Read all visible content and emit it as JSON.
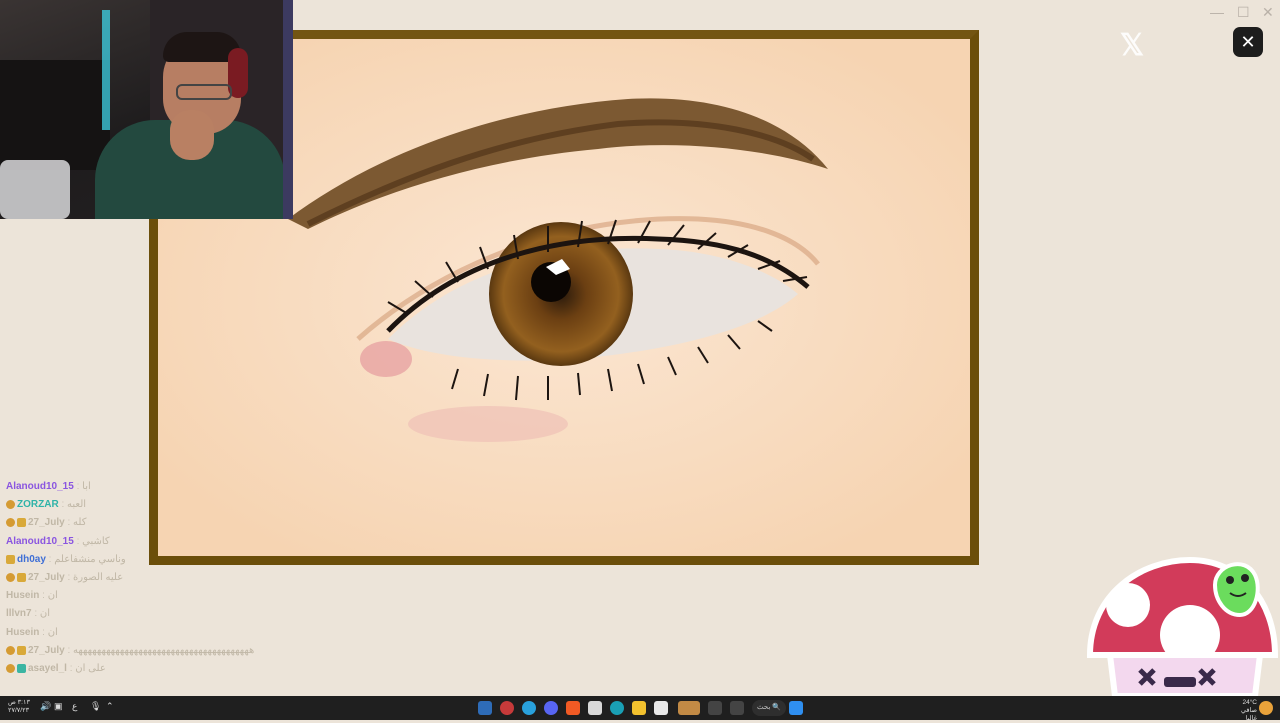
{
  "window": {
    "close_label": "✕",
    "minimize_label": "—",
    "maximize_label": "☐",
    "dismiss_label": "✕"
  },
  "icons": {
    "x_logo": "x-logo-icon"
  },
  "chat": {
    "messages": [
      {
        "user": "Alanoud10_15",
        "text": "ابا",
        "user_color": "#8a55e0",
        "badge": ""
      },
      {
        "user": "ZORZAR",
        "text": "العبه",
        "user_color": "#2fb3a8",
        "badge": "coin"
      },
      {
        "user": "27_July",
        "text": "كله",
        "user_color": "#c0b7a6",
        "badge": "coin-box"
      },
      {
        "user": "Alanoud10_15",
        "text": "كاشبي",
        "user_color": "#8a55e0",
        "badge": ""
      },
      {
        "user": "dh0ay",
        "text": "وناسي منشفاعلم",
        "user_color": "#3f6fd6",
        "badge": "box"
      },
      {
        "user": "27_July",
        "text": "عليه الصورة",
        "user_color": "#c0b7a6",
        "badge": "coin-box"
      },
      {
        "user": "Husein",
        "text": "ان",
        "user_color": "#c0b7a6",
        "badge": ""
      },
      {
        "user": "lllvn7",
        "text": "ان",
        "user_color": "#c0b7a6",
        "badge": ""
      },
      {
        "user": "Husein",
        "text": "ان",
        "user_color": "#c0b7a6",
        "badge": ""
      },
      {
        "user": "27_July",
        "text": "ههههههههههههههههههههههههههههههههههههههه",
        "user_color": "#c0b7a6",
        "badge": "coin-box"
      },
      {
        "user": "asayel_l",
        "text": "على ان",
        "user_color": "#c0b7a6",
        "badge": "coin-teal"
      }
    ]
  },
  "taskbar": {
    "time": "٣:١٣ ص",
    "date": "٢٧/٧/٢٣",
    "lang": "ع",
    "search_label": "بحث",
    "weather_temp": "24°C",
    "weather_desc": "صافي غالبا"
  },
  "colors": {
    "frame": "#6b4e0a",
    "canvas": "#fae3cc",
    "background": "#ece4d9",
    "taskbar": "#1f1f1f"
  }
}
